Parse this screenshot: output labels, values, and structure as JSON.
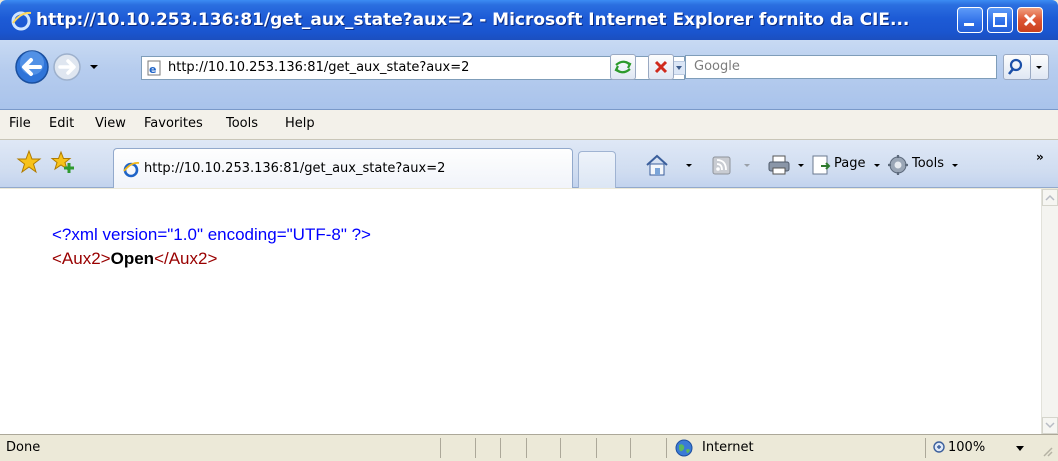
{
  "window": {
    "title": "http://10.10.253.136:81/get_aux_state?aux=2 - Microsoft Internet Explorer fornito da CIE..."
  },
  "address_bar": {
    "url": "http://10.10.253.136:81/get_aux_state?aux=2"
  },
  "search": {
    "placeholder": "Google"
  },
  "menu": {
    "items": [
      "File",
      "Edit",
      "View",
      "Favorites",
      "Tools",
      "Help"
    ]
  },
  "tabs": [
    {
      "label": "http://10.10.253.136:81/get_aux_state?aux=2"
    }
  ],
  "toolbar": {
    "page_label": "Page",
    "tools_label": "Tools",
    "more": "»"
  },
  "content": {
    "xml_declaration": "<?xml version=\"1.0\" encoding=\"UTF-8\" ?>",
    "open_tag": "<Aux2>",
    "value": "Open",
    "close_tag": "</Aux2>"
  },
  "status": {
    "text": "Done",
    "zone": "Internet",
    "zoom": "100%"
  },
  "colors": {
    "titlebar": "#1d5bd6",
    "xml_pi": "#0000ff",
    "xml_tag": "#990000"
  },
  "icons": [
    "ie-logo-icon",
    "back-arrow-icon",
    "forward-arrow-icon",
    "page-icon",
    "refresh-icon",
    "stop-icon",
    "search-icon",
    "favorites-star-icon",
    "add-favorites-icon",
    "home-icon",
    "feeds-icon",
    "print-icon",
    "page-icon",
    "tools-gear-icon",
    "globe-icon",
    "zoom-icon"
  ]
}
